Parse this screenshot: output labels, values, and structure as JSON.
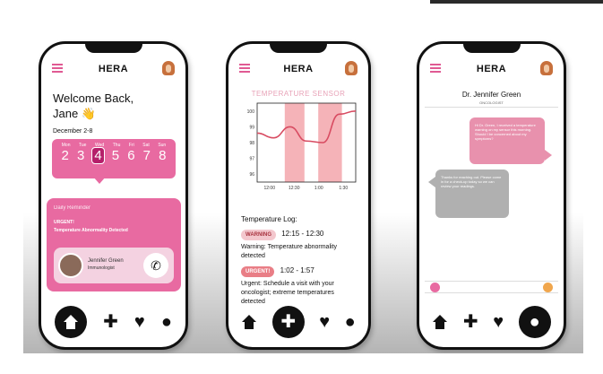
{
  "app_name": "HERA",
  "phone1": {
    "welcome": "Welcome Back,",
    "user": "Jane 👋",
    "date": "December 2-8",
    "weekdays": [
      "Mon",
      "Tue",
      "Wed",
      "Thu",
      "Fri",
      "Sat",
      "Sun"
    ],
    "days": [
      "2",
      "3",
      "4",
      "5",
      "6",
      "7",
      "8"
    ],
    "notice_title": "Daily Reminder",
    "notice_line1": "URGENT!",
    "notice_line2": "Temperature Abnormality Detected",
    "doctor_name": "Jennifer Green",
    "doctor_role": "Immunologist"
  },
  "phone2": {
    "sensor_title": "TEMPERATURE SENSOR",
    "log_title": "Temperature Log:",
    "warning_badge": "WARNING",
    "warning_time": "12:15 - 12:30",
    "warning_text": "Warning: Temperature abnormality detected",
    "urgent_badge": "URGENT!",
    "urgent_time": "1:02 - 1:57",
    "urgent_text": "Urgent: Schedule a visit with your oncologist; extreme temperatures detected"
  },
  "phone3": {
    "doctor": "Dr. Jennifer Green",
    "doctor_sub": "ONCOLOGIST",
    "msg_out": "Hi Dr. Green, I received a temperature warning on my sensor this morning. Should I be concerned about my symptoms?",
    "msg_in": "Thanks for reaching out. Please come in for a check-up today so we can review your readings."
  },
  "chart_data": {
    "type": "line",
    "title": "TEMPERATURE SENSOR",
    "x": [
      "12:00",
      "12:30",
      "1:00",
      "1:30"
    ],
    "y_ticks": [
      96,
      97,
      98,
      99,
      100
    ],
    "ylim": [
      95.5,
      100.5
    ],
    "values": [
      98.6,
      98.3,
      99.0,
      98.1,
      98.0,
      99.8,
      100.0
    ],
    "highlight_bands": [
      [
        0.28,
        0.48
      ],
      [
        0.62,
        0.86
      ]
    ],
    "line_color": "#d84b61",
    "band_color": "#f5b3b8"
  },
  "colors": {
    "accent": "#e86aa1",
    "accent_dark": "#b51f6a",
    "warn": "#f3c7cd",
    "urgent": "#e97e86"
  }
}
